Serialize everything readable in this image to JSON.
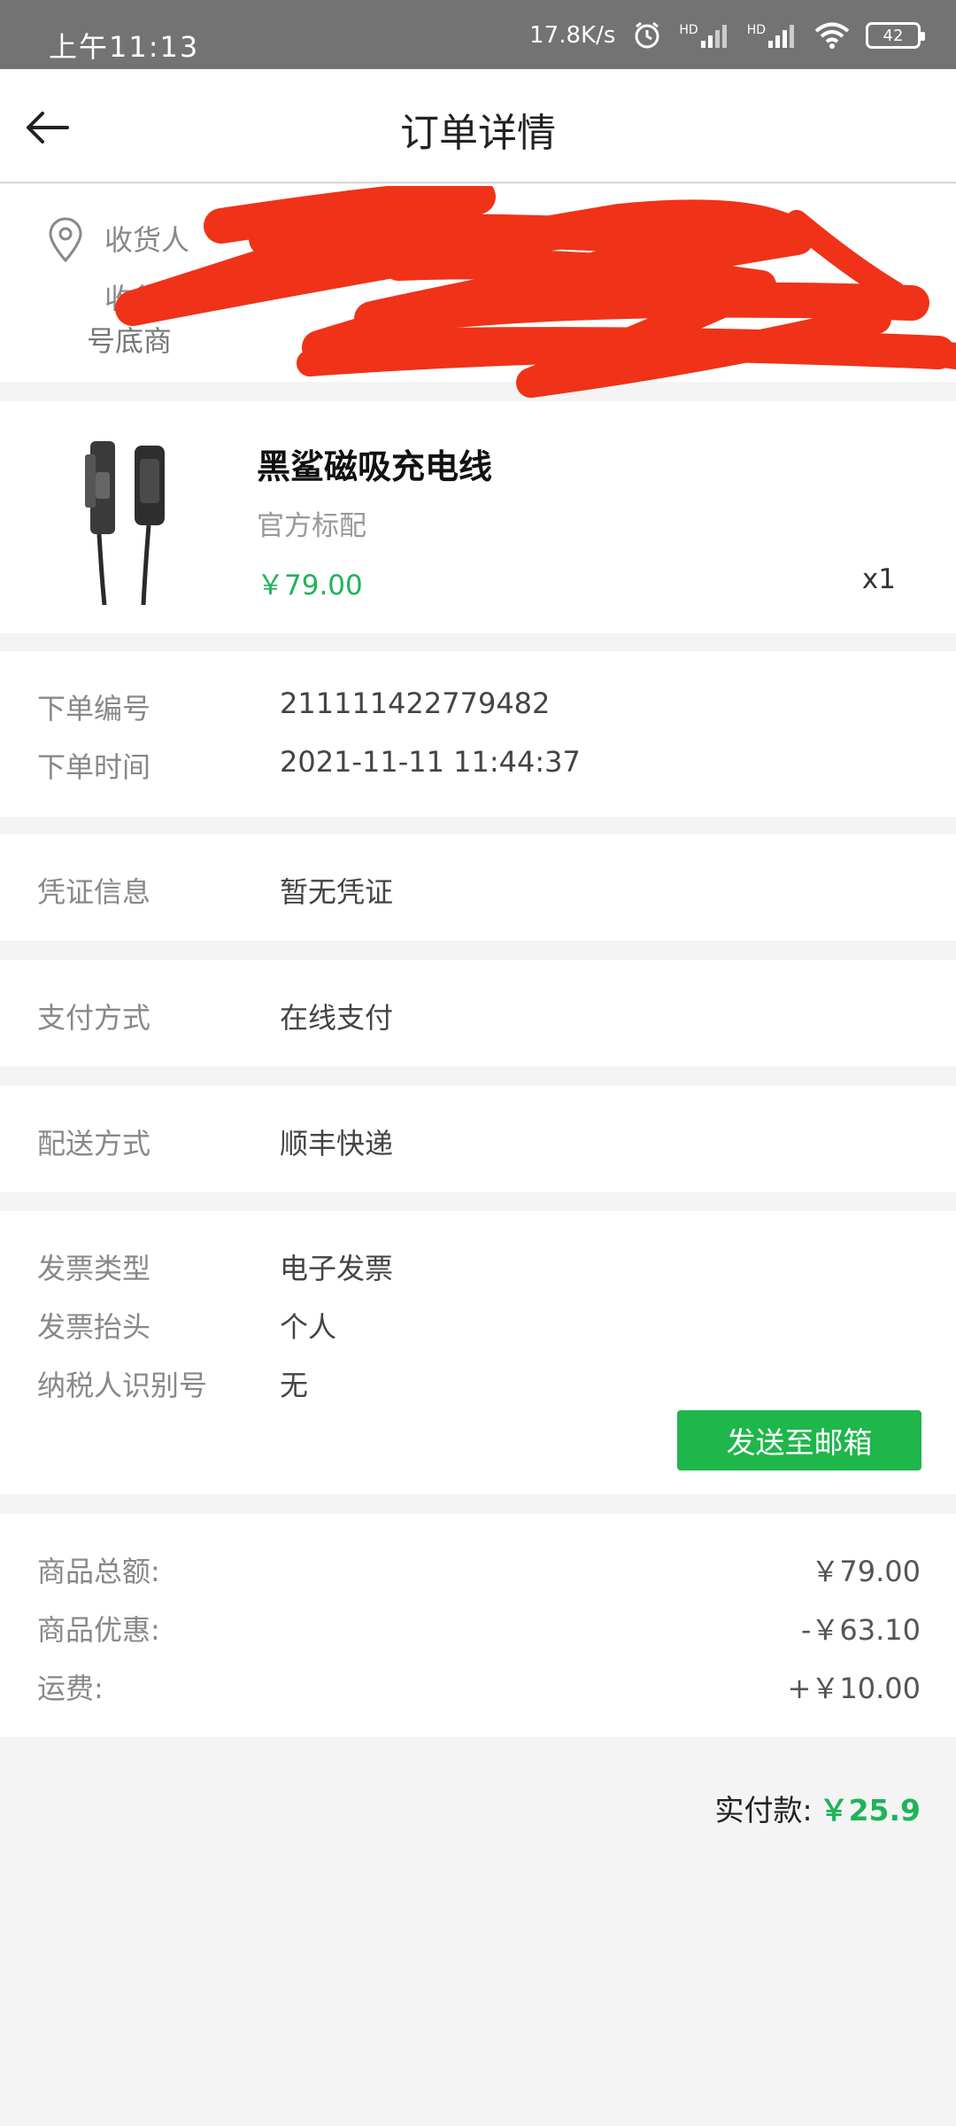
{
  "status_bar": {
    "time": "上午11:13",
    "net_speed": "17.8K/s",
    "signal_1": "HD",
    "signal_2": "HD",
    "battery": "42"
  },
  "header": {
    "title": "订单详情",
    "back_icon": "arrow-left-icon"
  },
  "address": {
    "icon": "location-pin-icon",
    "receiver_label": "收货人",
    "address_label": "收货地",
    "line3": "号底商"
  },
  "product": {
    "name": "黑鲨磁吸充电线",
    "spec": "官方标配",
    "price": "￥79.00",
    "quantity": "x1"
  },
  "order_info": {
    "order_no_label": "下单编号",
    "order_no": "211111422779482",
    "order_time_label": "下单时间",
    "order_time": "2021-11-11 11:44:37"
  },
  "voucher": {
    "label": "凭证信息",
    "value": "暂无凭证"
  },
  "payment": {
    "label": "支付方式",
    "value": "在线支付"
  },
  "delivery": {
    "label": "配送方式",
    "value": "顺丰快递"
  },
  "invoice": {
    "type_label": "发票类型",
    "type_value": "电子发票",
    "title_label": "发票抬头",
    "title_value": "个人",
    "tax_label": "纳税人识别号",
    "tax_value": "无",
    "send_button": "发送至邮箱"
  },
  "summary": {
    "total_label": "商品总额:",
    "total_value": "￥79.00",
    "discount_label": "商品优惠:",
    "discount_value": "-￥63.10",
    "shipping_label": "运费:",
    "shipping_value": "+￥10.00"
  },
  "paid": {
    "label": "实付款:",
    "value": "￥25.9"
  },
  "colors": {
    "accent_green": "#1fb35a",
    "button_green": "#1fb64b",
    "status_bar": "#737373",
    "redaction": "#f03218"
  }
}
